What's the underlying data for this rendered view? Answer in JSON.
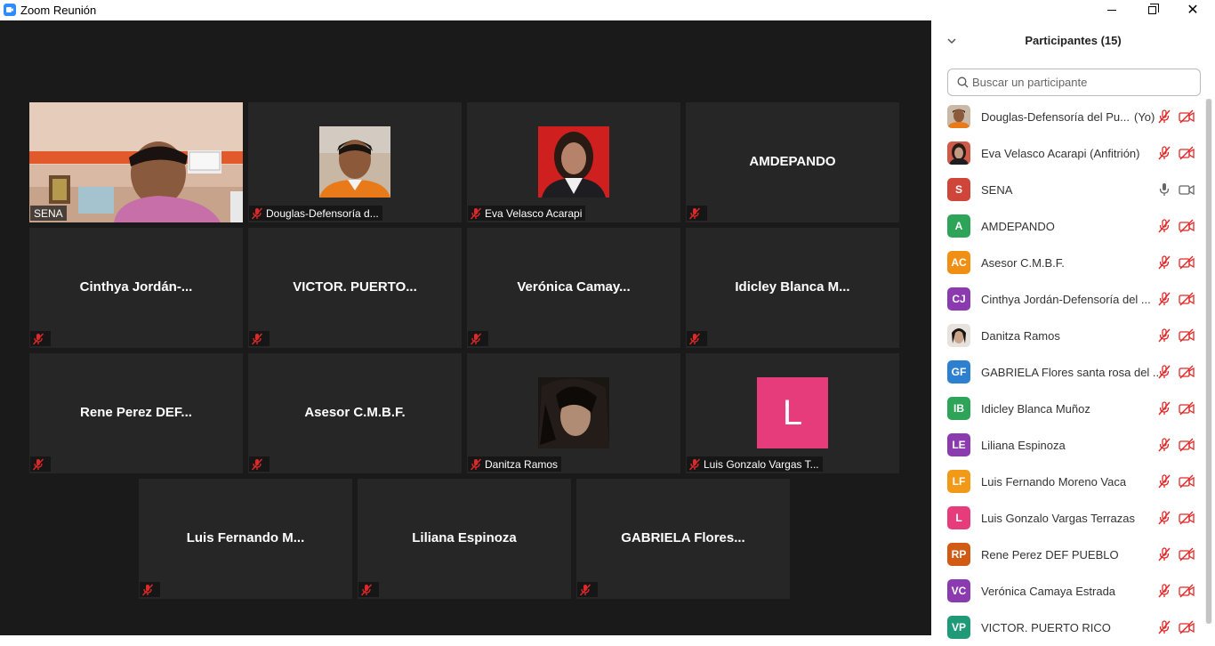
{
  "window": {
    "title": "Zoom Reunión"
  },
  "colors": {
    "active_border": "#ecf47d",
    "muted_red": "#e02828",
    "tile_bg": "#262626",
    "grid_bg": "#1a1a1a"
  },
  "tiles": [
    {
      "label": "SENA",
      "type": "video",
      "active": true
    },
    {
      "label": "Douglas-Defensoría d...",
      "type": "photo"
    },
    {
      "label": "Eva Velasco Acarapi",
      "type": "photo"
    },
    {
      "name": "AMDEPANDO",
      "type": "name"
    },
    {
      "name": "Cinthya  Jordán-...",
      "type": "name"
    },
    {
      "name": "VICTOR.  PUERTO...",
      "type": "name"
    },
    {
      "name": "Verónica  Camay...",
      "type": "name"
    },
    {
      "name": "Idicley Blanca M...",
      "type": "name"
    },
    {
      "name": "Rene Perez  DEF...",
      "type": "name"
    },
    {
      "name": "Asesor C.M.B.F.",
      "type": "name"
    },
    {
      "label": "Danitza Ramos",
      "type": "photo"
    },
    {
      "label": "Luis Gonzalo Vargas T...",
      "type": "letter",
      "letter": "L",
      "letter_color": "#e63c7c"
    },
    {
      "name": "Luis Fernando  M...",
      "type": "name"
    },
    {
      "name": "Liliana Espinoza",
      "type": "name"
    },
    {
      "name": "GABRIELA  Flores...",
      "type": "name"
    }
  ],
  "panel": {
    "title": "Participantes (15)",
    "search_placeholder": "Buscar un participante",
    "participants": [
      {
        "name": "Douglas-Defensoría del Pu...",
        "tag": "(Yo)",
        "avatar": "photo",
        "mic": "muted",
        "cam": "off"
      },
      {
        "name": "Eva Velasco Acarapi (Anfitrión)",
        "avatar": "photo",
        "mic": "muted",
        "cam": "off"
      },
      {
        "name": "SENA",
        "initials": "S",
        "color": "#d0453a",
        "mic": "on",
        "cam": "on"
      },
      {
        "name": "AMDEPANDO",
        "initials": "A",
        "color": "#2ea458",
        "mic": "muted",
        "cam": "off"
      },
      {
        "name": "Asesor C.M.B.F.",
        "initials": "AC",
        "color": "#f08f14",
        "mic": "muted",
        "cam": "off"
      },
      {
        "name": "Cinthya Jordán-Defensoría del ...",
        "initials": "CJ",
        "color": "#8c3ab0",
        "mic": "muted",
        "cam": "off"
      },
      {
        "name": "Danitza Ramos",
        "avatar": "photo",
        "mic": "muted",
        "cam": "off"
      },
      {
        "name": "GABRIELA Flores santa rosa del ...",
        "initials": "GF",
        "color": "#2d7fd0",
        "mic": "muted",
        "cam": "off"
      },
      {
        "name": "Idicley Blanca Muñoz",
        "initials": "IB",
        "color": "#2ea458",
        "mic": "muted",
        "cam": "off"
      },
      {
        "name": "Liliana Espinoza",
        "initials": "LE",
        "color": "#8c3ab0",
        "mic": "muted",
        "cam": "off"
      },
      {
        "name": "Luis Fernando Moreno Vaca",
        "initials": "LF",
        "color": "#f29a18",
        "mic": "muted",
        "cam": "off"
      },
      {
        "name": "Luis Gonzalo Vargas Terrazas",
        "initials": "L",
        "color": "#e63c7c",
        "mic": "muted",
        "cam": "off"
      },
      {
        "name": "Rene Perez DEF PUEBLO",
        "initials": "RP",
        "color": "#d15a14",
        "mic": "muted",
        "cam": "off"
      },
      {
        "name": "Verónica Camaya Estrada",
        "initials": "VC",
        "color": "#8c3ab0",
        "mic": "muted",
        "cam": "off"
      },
      {
        "name": "VICTOR. PUERTO RICO",
        "initials": "VP",
        "color": "#1f9a78",
        "mic": "muted",
        "cam": "off"
      }
    ]
  }
}
